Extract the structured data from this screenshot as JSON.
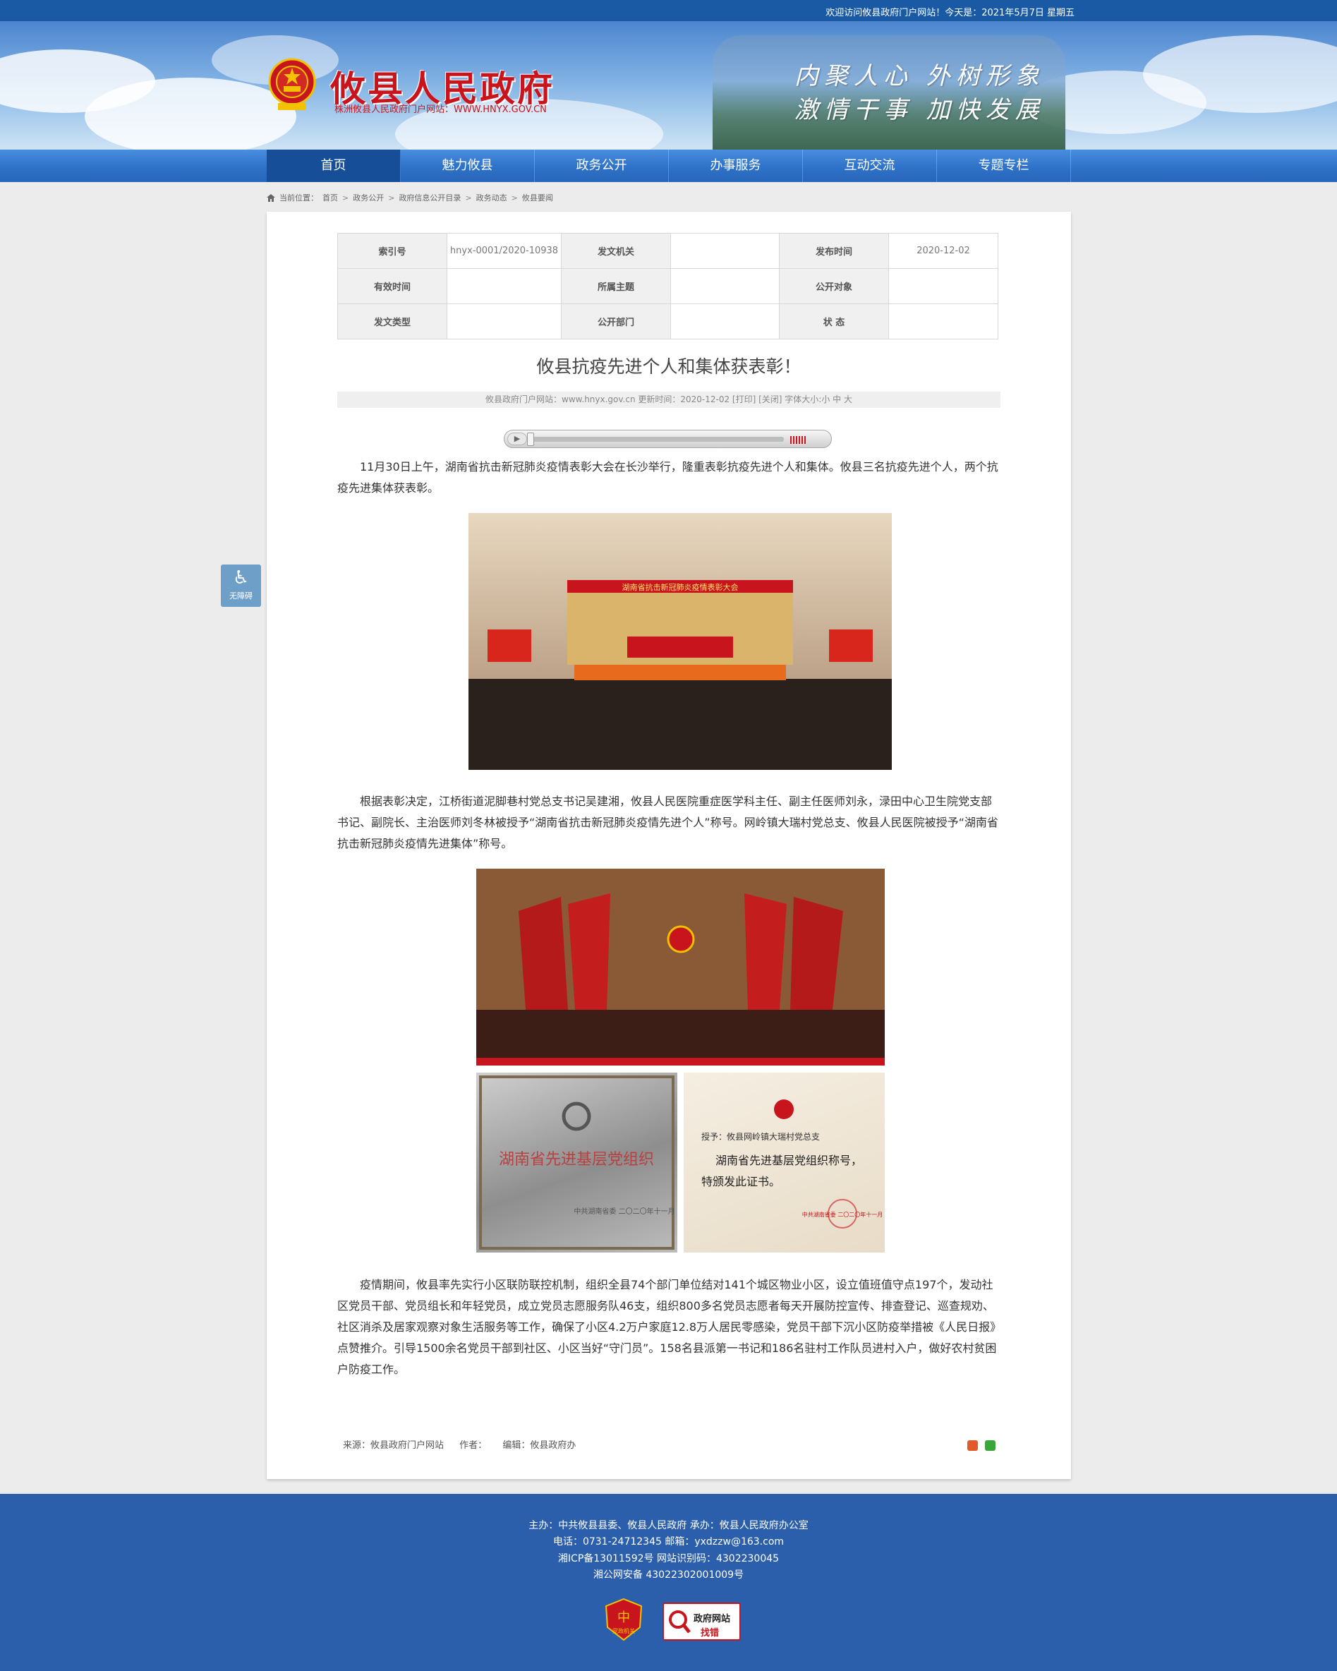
{
  "topbar": {
    "welcome": "欢迎访问攸县政府门户网站！今天是：2021年5月7日 星期五"
  },
  "header": {
    "site_name": "攸县人民政府",
    "site_sub": "株洲攸县人民政府门户网站：WWW.HNYX.GOV.CN",
    "slogan_1": "内聚人心  外树形象",
    "slogan_2": "激情干事  加快发展"
  },
  "nav": {
    "items": [
      "首页",
      "魅力攸县",
      "政务公开",
      "办事服务",
      "互动交流",
      "专题专栏"
    ],
    "active_index": 0
  },
  "breadcrumb": {
    "label": "当前位置：",
    "items": [
      "首页",
      "政务公开",
      "政府信息公开目录",
      "政务动态",
      "攸县要闻"
    ],
    "separator": ">"
  },
  "info_table": {
    "rows": [
      [
        {
          "k": "索引号",
          "v": "hnyx-0001/2020-10938"
        },
        {
          "k": "发文机关",
          "v": ""
        },
        {
          "k": "发布时间",
          "v": "2020-12-02"
        }
      ],
      [
        {
          "k": "有效时间",
          "v": ""
        },
        {
          "k": "所属主题",
          "v": ""
        },
        {
          "k": "公开对象",
          "v": ""
        }
      ],
      [
        {
          "k": "发文类型",
          "v": ""
        },
        {
          "k": "公开部门",
          "v": ""
        },
        {
          "k": "状  态",
          "v": ""
        }
      ]
    ]
  },
  "article": {
    "title": "攸县抗疫先进个人和集体获表彰！",
    "meta": "攸县政府门户网站：www.hnyx.gov.cn  更新时间：2020-12-02  [打印] [关闭]  字体大小:小 中 大",
    "paragraphs": [
      "11月30日上午，湖南省抗击新冠肺炎疫情表彰大会在长沙举行，隆重表彰抗疫先进个人和集体。攸县三名抗疫先进个人，两个抗疫先进集体获表彰。",
      "根据表彰决定，江桥街道泥脚巷村党总支书记吴建湘，攸县人民医院重症医学科主任、副主任医师刘永，渌田中心卫生院党支部书记、副院长、主治医师刘冬林被授予“湖南省抗击新冠肺炎疫情先进个人”称号。网岭镇大瑞村党总支、攸县人民医院被授予“湖南省抗击新冠肺炎疫情先进集体”称号。",
      "疫情期间，攸县率先实行小区联防联控机制，组织全县74个部门单位结对141个城区物业小区，设立值班值守点197个，发动社区党员干部、党员组长和年轻党员，成立党员志愿服务队46支，组织800多名党员志愿者每天开展防控宣传、排查登记、巡查规劝、社区消杀及居家观察对象生活服务等工作，确保了小区4.2万户家庭12.8万人居民零感染，党员干部下沉小区防疫举措被《人民日报》点赞推介。引导1500余名党员干部到社区、小区当好“守门员”。158名县派第一书记和186名驻村工作队员进村入户，做好农村贫困户防疫工作。"
    ],
    "photo1_banner": "湖南省抗击新冠肺炎疫情表彰大会",
    "photo3_text": "湖南省先进基层党组织",
    "photo3_small": "中共湖南省委 二〇二〇年十一月",
    "photo4_line1": "授予：攸县网岭镇大瑞村党总支",
    "photo4_line2": "湖南省先进基层党组织称号，",
    "photo4_line3": "特颁发此证书。",
    "photo4_small": "中共湖南省委 二〇二〇年十一月"
  },
  "source_line": {
    "source": "来源：攸县政府门户网站",
    "author": "作者：",
    "editor": "编辑：攸县政府办"
  },
  "accessibility": {
    "label": "无障碍",
    "icon": "wheelchair-icon"
  },
  "footer": {
    "line1": "主办：中共攸县县委、攸县人民政府 承办：攸县人民政府办公室",
    "line2": "电话：0731-24712345 邮箱：yxdzzw@163.com",
    "line3": "湘ICP备13011592号    网站识别码：4302230045",
    "line4": "湘公网安备 43022302001009号",
    "badge1_label": "党政机关",
    "badge2_line1": "政府网站",
    "badge2_line2": "找错"
  },
  "colors": {
    "brand_red": "#c8151d",
    "nav_blue": "#2e72c9",
    "footer_blue": "#2b5eab"
  }
}
